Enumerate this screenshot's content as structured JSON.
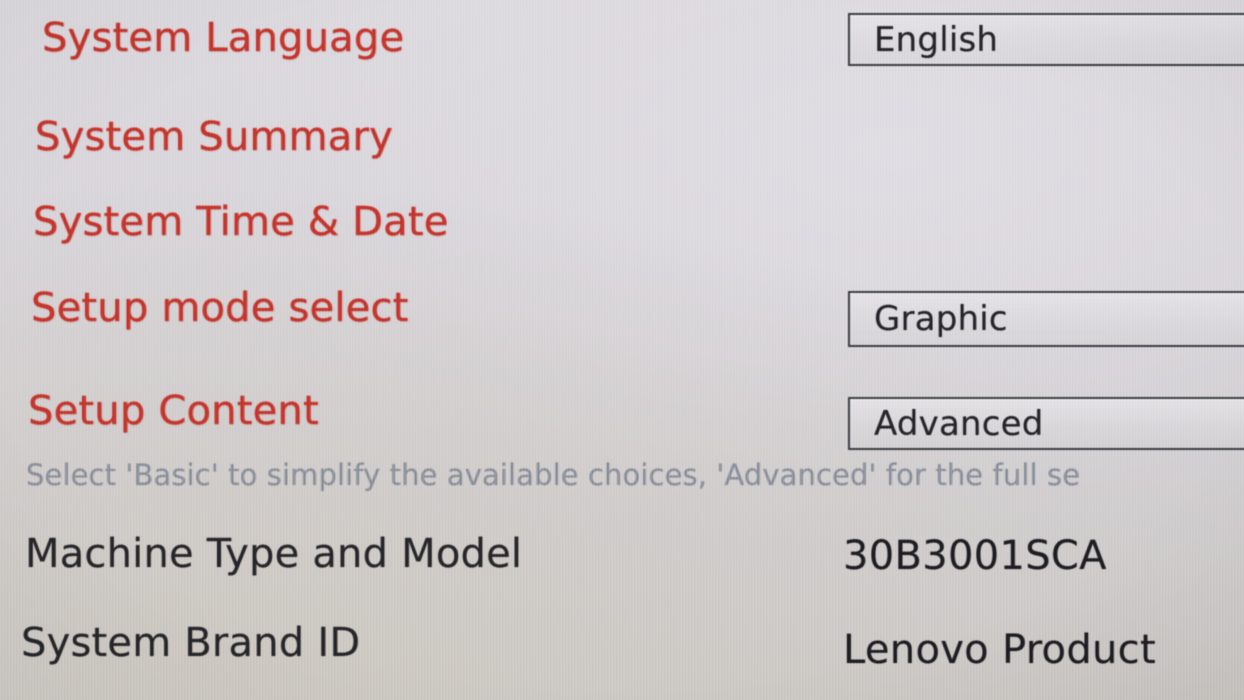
{
  "screen": {
    "kind": "bios-setup-main-page",
    "vendor_value_hint": "Lenovo",
    "background_color": "#d3d0d4",
    "menu_label_color": "#c5352c",
    "info_label_color": "#26262a",
    "help_text_color": "#8b909b",
    "field_border_color": "#3a3d40"
  },
  "rows": [
    {
      "id": "system-language",
      "label": "System Language",
      "type": "select",
      "value": "English"
    },
    {
      "id": "system-summary",
      "label": "System Summary",
      "type": "submenu",
      "value": ""
    },
    {
      "id": "system-time-and-date",
      "label": "System Time & Date",
      "type": "submenu",
      "value": ""
    },
    {
      "id": "setup-mode-select",
      "label": "Setup mode select",
      "type": "select",
      "value": "Graphic"
    },
    {
      "id": "setup-content",
      "label": "Setup Content",
      "type": "select",
      "value": "Advanced",
      "help": "Select 'Basic' to simplify the available choices, 'Advanced' for the full se"
    },
    {
      "id": "machine-type-and-model",
      "label": "Machine Type and Model",
      "type": "readonly",
      "value": "30B3001SCA"
    },
    {
      "id": "system-brand-id",
      "label": "System Brand ID",
      "type": "readonly",
      "value": "Lenovo Product"
    }
  ]
}
